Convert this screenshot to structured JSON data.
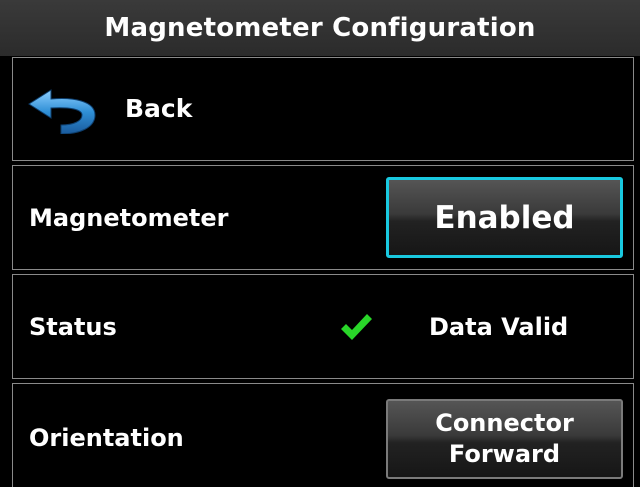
{
  "header": {
    "title": "Magnetometer Configuration"
  },
  "back_row": {
    "label": "Back",
    "icon": "back-arrow-icon"
  },
  "magnetometer_row": {
    "label": "Magnetometer",
    "button_label": "Enabled"
  },
  "status_row": {
    "label": "Status",
    "icon": "check-icon",
    "value": "Data Valid"
  },
  "orientation_row": {
    "label": "Orientation",
    "button_line1": "Connector",
    "button_line2": "Forward"
  },
  "colors": {
    "background": "#000000",
    "header": "#2f2f2f",
    "selection_border": "#19c9e0",
    "back_arrow": "#2f8fd6",
    "valid_check": "#29d629",
    "text": "#ffffff"
  }
}
